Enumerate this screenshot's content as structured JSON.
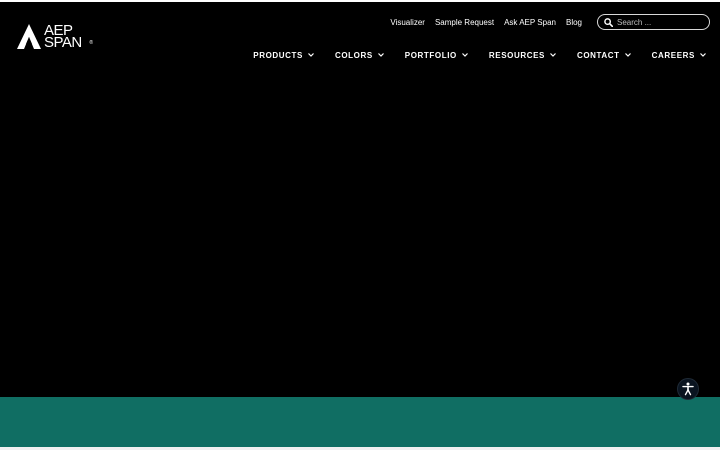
{
  "brand": {
    "logo_line1": "AEP",
    "logo_line2": "SPAN",
    "logo_registered": "®",
    "colors": {
      "hero_bg": "#000000",
      "teal": "#106e63",
      "text": "#ffffff"
    }
  },
  "utility_nav": {
    "links": [
      "Visualizer",
      "Sample Request",
      "Ask AEP Span",
      "Blog"
    ],
    "search_placeholder": "Search ..."
  },
  "main_nav": {
    "items": [
      "PRODUCTS",
      "COLORS",
      "PORTFOLIO",
      "RESOURCES",
      "CONTACT",
      "CAREERS"
    ]
  },
  "icons": {
    "search": "search-icon",
    "chevron": "chevron-down-icon",
    "accessibility": "accessibility-icon",
    "logo_mark": "aep-span-logo-mark"
  }
}
